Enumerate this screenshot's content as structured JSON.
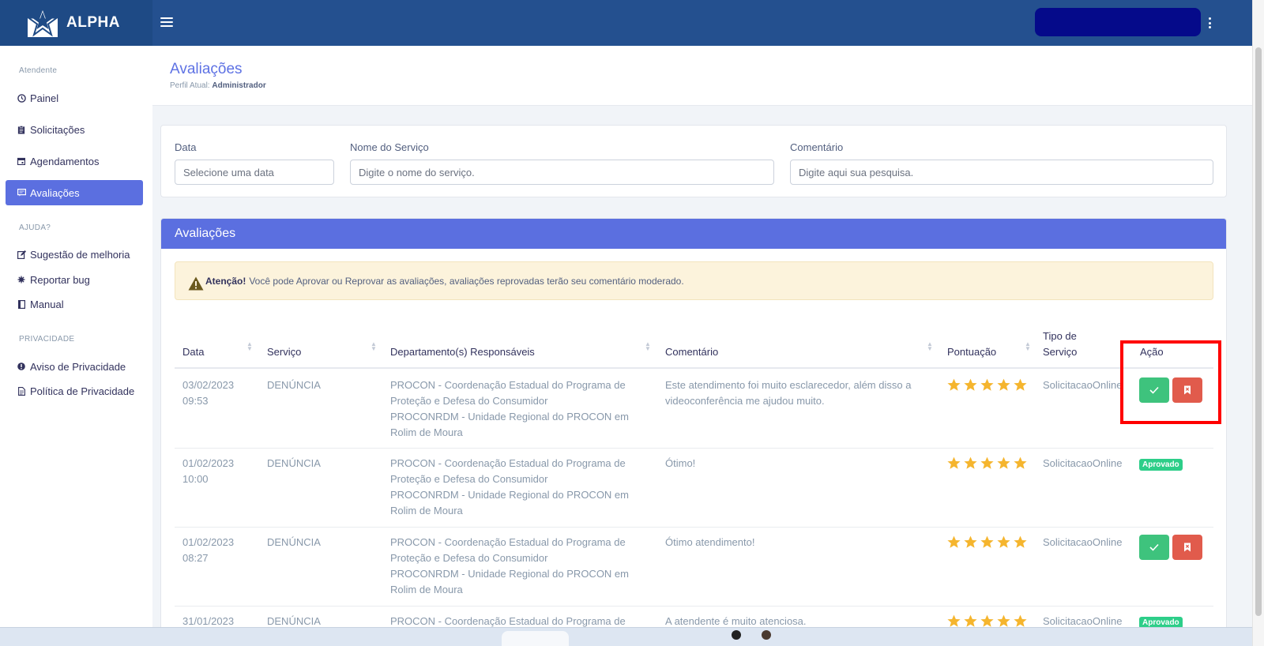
{
  "brand": {
    "name": "ALPHA"
  },
  "sidebar": {
    "sections": [
      {
        "label": "Atendente"
      },
      {
        "label": "AJUDA?"
      },
      {
        "label": "PRIVACIDADE"
      }
    ],
    "items": [
      {
        "label": "Painel",
        "icon": "clock-icon"
      },
      {
        "label": "Solicitações",
        "icon": "clipboard-icon"
      },
      {
        "label": "Agendamentos",
        "icon": "calendar-icon"
      },
      {
        "label": "Avaliações",
        "icon": "comment-icon",
        "active": true
      },
      {
        "label": "Sugestão de melhoria",
        "icon": "edit-icon"
      },
      {
        "label": "Reportar bug",
        "icon": "bug-icon"
      },
      {
        "label": "Manual",
        "icon": "book-icon"
      },
      {
        "label": "Aviso de Privacidade",
        "icon": "exclamation-icon"
      },
      {
        "label": "Política de Privacidade",
        "icon": "document-icon"
      }
    ]
  },
  "page": {
    "title": "Avaliações",
    "profile_label": "Perfil Atual:",
    "profile_value": "Administrador"
  },
  "filters": {
    "date_label": "Data",
    "date_placeholder": "Selecione uma data",
    "service_label": "Nome do Serviço",
    "service_placeholder": "Digite o nome do serviço.",
    "comment_label": "Comentário",
    "comment_placeholder": "Digite aqui sua pesquisa."
  },
  "table_card": {
    "title": "Avaliações",
    "alert_strong": "Atenção!",
    "alert_text": "Você pode Aprovar ou Reprovar as avaliações, avaliações reprovadas terão seu comentário moderado.",
    "columns": [
      "Data",
      "Serviço",
      "Departamento(s) Responsáveis",
      "Comentário",
      "Pontuação",
      "Tipo de",
      "Serviço",
      "Ação"
    ],
    "rows": [
      {
        "date": "03/02/2023",
        "time": "09:53",
        "service": "DENÚNCIA",
        "dept": [
          "PROCON - Coordenação Estadual do Programa de",
          "Proteção e Defesa do Consumidor",
          "PROCONRDM - Unidade Regional do PROCON em",
          "Rolim de Moura"
        ],
        "comment": [
          "Este atendimento foi muito esclarecedor, além disso a",
          "videoconferência me ajudou muito."
        ],
        "score": 5,
        "type": "SolicitacaoOnline",
        "status": "pending"
      },
      {
        "date": "01/02/2023",
        "time": "10:00",
        "service": "DENÚNCIA",
        "dept": [
          "PROCON - Coordenação Estadual do Programa de",
          "Proteção e Defesa do Consumidor",
          "PROCONRDM - Unidade Regional do PROCON em",
          "Rolim de Moura"
        ],
        "comment": [
          "Ótimo!"
        ],
        "score": 5,
        "type": "SolicitacaoOnline",
        "status": "approved",
        "badge": "Aprovado"
      },
      {
        "date": "01/02/2023",
        "time": "08:27",
        "service": "DENÚNCIA",
        "dept": [
          "PROCON - Coordenação Estadual do Programa de",
          "Proteção e Defesa do Consumidor",
          "PROCONRDM - Unidade Regional do PROCON em",
          "Rolim de Moura"
        ],
        "comment": [
          "Ótimo atendimento!"
        ],
        "score": 5,
        "type": "SolicitacaoOnline",
        "status": "pending"
      },
      {
        "date": "31/01/2023",
        "time": "",
        "service": "DENÚNCIA",
        "dept": [
          "PROCON - Coordenação Estadual do Programa de"
        ],
        "comment": [
          "A atendente é muito atenciosa."
        ],
        "score": 5,
        "type": "SolicitacaoOnline",
        "status": "approved",
        "badge": "Aprovado"
      }
    ]
  },
  "colors": {
    "topbar": "#24508f",
    "accent": "#5b6fe0",
    "approve": "#3ec37d",
    "reject": "#e15b4c",
    "star": "#f5b52e",
    "highlight": "#ff0000"
  }
}
